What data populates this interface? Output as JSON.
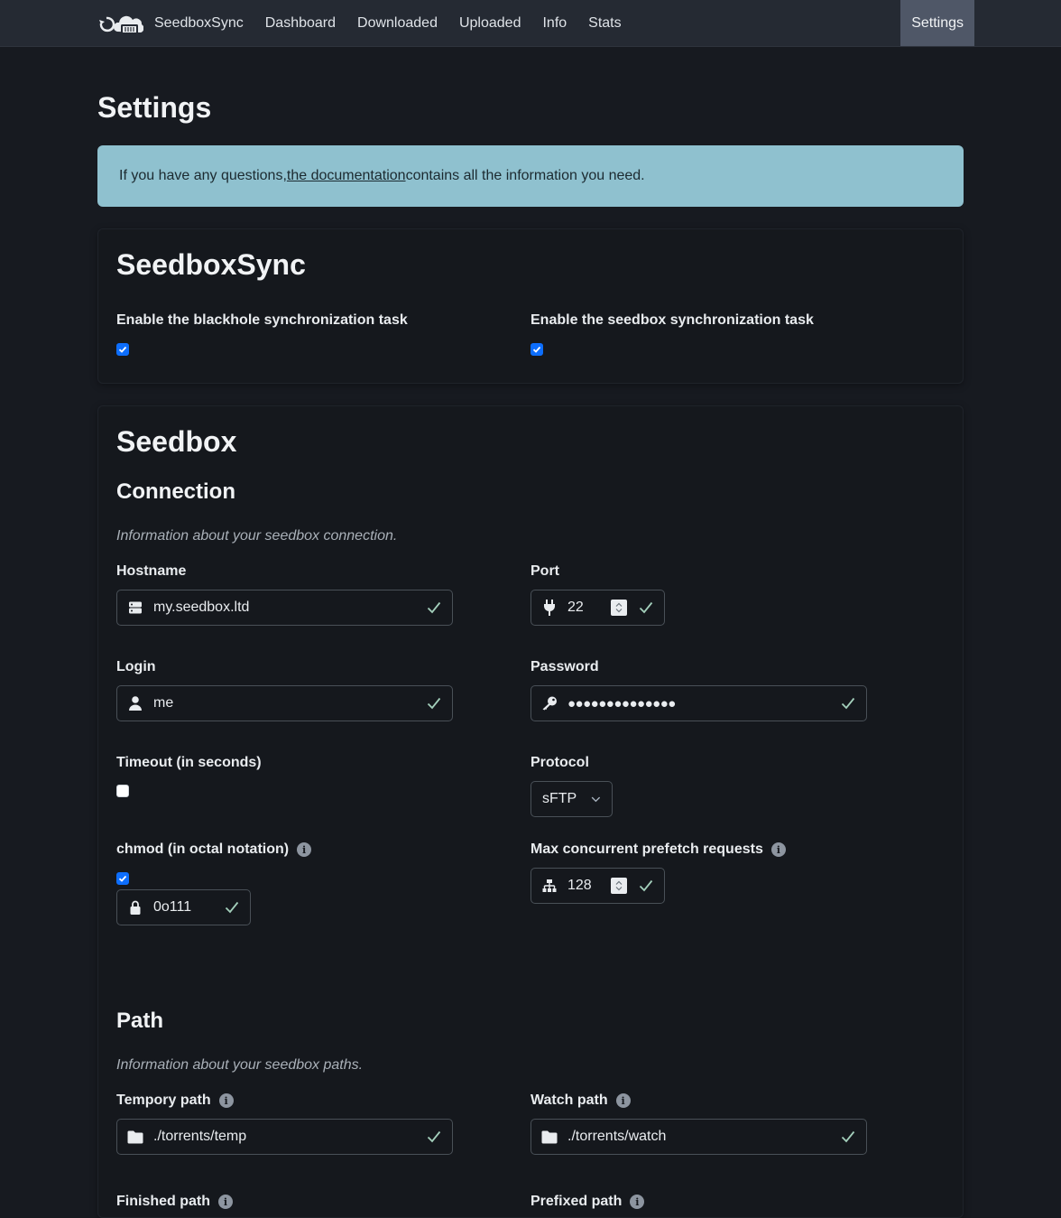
{
  "nav": {
    "brand": "SeedboxSync",
    "links": [
      "Dashboard",
      "Downloaded",
      "Uploaded",
      "Info",
      "Stats"
    ],
    "active": "Settings"
  },
  "page": {
    "title": "Settings",
    "alert": {
      "before": "If you have any questions, ",
      "link": "the documentation",
      "after": " contains all the information you need."
    }
  },
  "sync_card": {
    "title": "SeedboxSync",
    "blackhole_label": "Enable the blackhole synchronization task",
    "blackhole_enabled": true,
    "seedbox_label": "Enable the seedbox synchronization task",
    "seedbox_enabled": true
  },
  "seedbox_card": {
    "title": "Seedbox",
    "connection": {
      "title": "Connection",
      "desc": "Information about your seedbox connection.",
      "hostname_label": "Hostname",
      "hostname": "my.seedbox.ltd",
      "port_label": "Port",
      "port": "22",
      "login_label": "Login",
      "login": "me",
      "password_label": "Password",
      "password": "●●●●●●●●●●●●●●",
      "timeout_label": "Timeout (in seconds)",
      "timeout_enabled": false,
      "protocol_label": "Protocol",
      "protocol": "sFTP",
      "chmod_label": "chmod (in octal notation)",
      "chmod_enabled": true,
      "chmod": "0o111",
      "prefetch_label": "Max concurrent prefetch requests",
      "prefetch": "128"
    },
    "path": {
      "title": "Path",
      "desc": "Information about your seedbox paths.",
      "tmp_label": "Tempory path",
      "tmp": "./torrents/temp",
      "watch_label": "Watch path",
      "watch": "./torrents/watch",
      "finished_label": "Finished path",
      "prefixed_label": "Prefixed path"
    }
  },
  "colors": {
    "accent": "#0d6efd",
    "valid": "#a3cfbb",
    "alert_bg": "#8fc1cf"
  }
}
